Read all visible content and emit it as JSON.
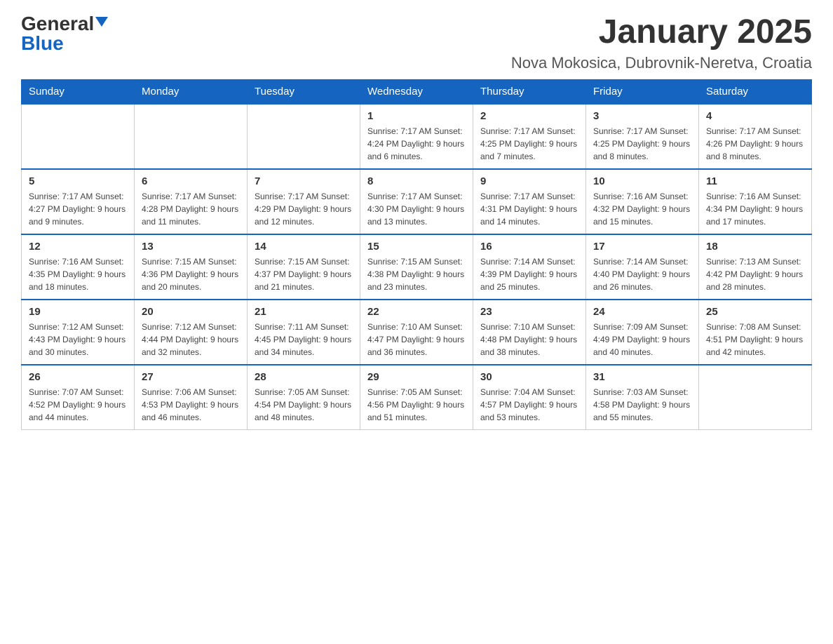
{
  "header": {
    "logo": {
      "general": "General",
      "blue": "Blue",
      "triangle_alt": "triangle"
    },
    "title": "January 2025",
    "subtitle": "Nova Mokosica, Dubrovnik-Neretva, Croatia"
  },
  "days_of_week": [
    "Sunday",
    "Monday",
    "Tuesday",
    "Wednesday",
    "Thursday",
    "Friday",
    "Saturday"
  ],
  "weeks": [
    {
      "days": [
        {
          "number": "",
          "info": ""
        },
        {
          "number": "",
          "info": ""
        },
        {
          "number": "",
          "info": ""
        },
        {
          "number": "1",
          "info": "Sunrise: 7:17 AM\nSunset: 4:24 PM\nDaylight: 9 hours and 6 minutes."
        },
        {
          "number": "2",
          "info": "Sunrise: 7:17 AM\nSunset: 4:25 PM\nDaylight: 9 hours and 7 minutes."
        },
        {
          "number": "3",
          "info": "Sunrise: 7:17 AM\nSunset: 4:25 PM\nDaylight: 9 hours and 8 minutes."
        },
        {
          "number": "4",
          "info": "Sunrise: 7:17 AM\nSunset: 4:26 PM\nDaylight: 9 hours and 8 minutes."
        }
      ]
    },
    {
      "days": [
        {
          "number": "5",
          "info": "Sunrise: 7:17 AM\nSunset: 4:27 PM\nDaylight: 9 hours and 9 minutes."
        },
        {
          "number": "6",
          "info": "Sunrise: 7:17 AM\nSunset: 4:28 PM\nDaylight: 9 hours and 11 minutes."
        },
        {
          "number": "7",
          "info": "Sunrise: 7:17 AM\nSunset: 4:29 PM\nDaylight: 9 hours and 12 minutes."
        },
        {
          "number": "8",
          "info": "Sunrise: 7:17 AM\nSunset: 4:30 PM\nDaylight: 9 hours and 13 minutes."
        },
        {
          "number": "9",
          "info": "Sunrise: 7:17 AM\nSunset: 4:31 PM\nDaylight: 9 hours and 14 minutes."
        },
        {
          "number": "10",
          "info": "Sunrise: 7:16 AM\nSunset: 4:32 PM\nDaylight: 9 hours and 15 minutes."
        },
        {
          "number": "11",
          "info": "Sunrise: 7:16 AM\nSunset: 4:34 PM\nDaylight: 9 hours and 17 minutes."
        }
      ]
    },
    {
      "days": [
        {
          "number": "12",
          "info": "Sunrise: 7:16 AM\nSunset: 4:35 PM\nDaylight: 9 hours and 18 minutes."
        },
        {
          "number": "13",
          "info": "Sunrise: 7:15 AM\nSunset: 4:36 PM\nDaylight: 9 hours and 20 minutes."
        },
        {
          "number": "14",
          "info": "Sunrise: 7:15 AM\nSunset: 4:37 PM\nDaylight: 9 hours and 21 minutes."
        },
        {
          "number": "15",
          "info": "Sunrise: 7:15 AM\nSunset: 4:38 PM\nDaylight: 9 hours and 23 minutes."
        },
        {
          "number": "16",
          "info": "Sunrise: 7:14 AM\nSunset: 4:39 PM\nDaylight: 9 hours and 25 minutes."
        },
        {
          "number": "17",
          "info": "Sunrise: 7:14 AM\nSunset: 4:40 PM\nDaylight: 9 hours and 26 minutes."
        },
        {
          "number": "18",
          "info": "Sunrise: 7:13 AM\nSunset: 4:42 PM\nDaylight: 9 hours and 28 minutes."
        }
      ]
    },
    {
      "days": [
        {
          "number": "19",
          "info": "Sunrise: 7:12 AM\nSunset: 4:43 PM\nDaylight: 9 hours and 30 minutes."
        },
        {
          "number": "20",
          "info": "Sunrise: 7:12 AM\nSunset: 4:44 PM\nDaylight: 9 hours and 32 minutes."
        },
        {
          "number": "21",
          "info": "Sunrise: 7:11 AM\nSunset: 4:45 PM\nDaylight: 9 hours and 34 minutes."
        },
        {
          "number": "22",
          "info": "Sunrise: 7:10 AM\nSunset: 4:47 PM\nDaylight: 9 hours and 36 minutes."
        },
        {
          "number": "23",
          "info": "Sunrise: 7:10 AM\nSunset: 4:48 PM\nDaylight: 9 hours and 38 minutes."
        },
        {
          "number": "24",
          "info": "Sunrise: 7:09 AM\nSunset: 4:49 PM\nDaylight: 9 hours and 40 minutes."
        },
        {
          "number": "25",
          "info": "Sunrise: 7:08 AM\nSunset: 4:51 PM\nDaylight: 9 hours and 42 minutes."
        }
      ]
    },
    {
      "days": [
        {
          "number": "26",
          "info": "Sunrise: 7:07 AM\nSunset: 4:52 PM\nDaylight: 9 hours and 44 minutes."
        },
        {
          "number": "27",
          "info": "Sunrise: 7:06 AM\nSunset: 4:53 PM\nDaylight: 9 hours and 46 minutes."
        },
        {
          "number": "28",
          "info": "Sunrise: 7:05 AM\nSunset: 4:54 PM\nDaylight: 9 hours and 48 minutes."
        },
        {
          "number": "29",
          "info": "Sunrise: 7:05 AM\nSunset: 4:56 PM\nDaylight: 9 hours and 51 minutes."
        },
        {
          "number": "30",
          "info": "Sunrise: 7:04 AM\nSunset: 4:57 PM\nDaylight: 9 hours and 53 minutes."
        },
        {
          "number": "31",
          "info": "Sunrise: 7:03 AM\nSunset: 4:58 PM\nDaylight: 9 hours and 55 minutes."
        },
        {
          "number": "",
          "info": ""
        }
      ]
    }
  ]
}
